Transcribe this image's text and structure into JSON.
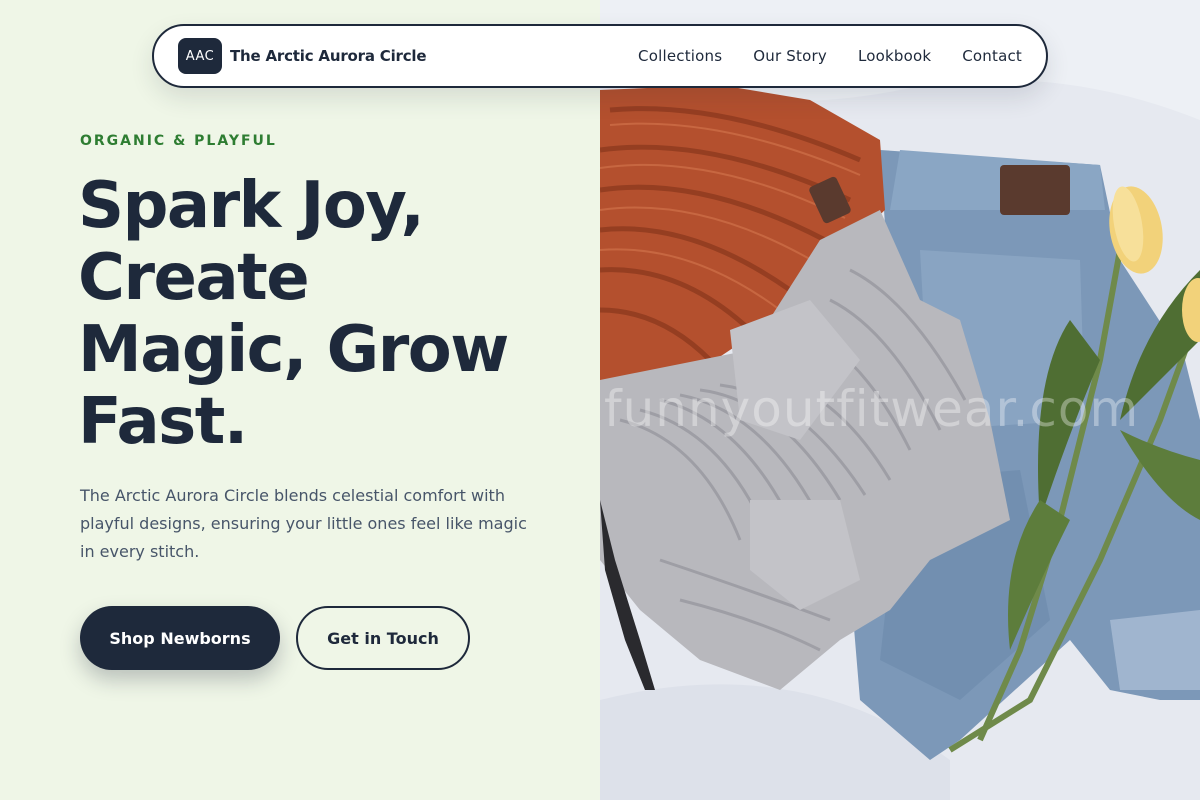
{
  "nav": {
    "logo_text": "AAC",
    "brand_name": "The Arctic Aurora Circle",
    "links": [
      "Collections",
      "Our Story",
      "Lookbook",
      "Contact"
    ]
  },
  "hero": {
    "eyebrow": "ORGANIC & PLAYFUL",
    "headline_lines": [
      "Spark Joy,",
      "Create",
      "Magic, Grow",
      "Fast."
    ],
    "description": "The Arctic Aurora Circle blends celestial comfort with playful designs, ensuring your little ones feel like magic in every stitch.",
    "primary_cta": "Shop Newborns",
    "secondary_cta": "Get in Touch"
  },
  "image": {
    "subject": "flat-lay of knitted rust beanie, grey ribbed sweater, blue jeans and yellow tulips on white sheet",
    "watermark": "funnyoutfitwear.com"
  },
  "colors": {
    "navy": "#1e293b",
    "accent_green": "#2e7d32",
    "panel_bg": "#eff6e7",
    "body_text": "#475569"
  }
}
